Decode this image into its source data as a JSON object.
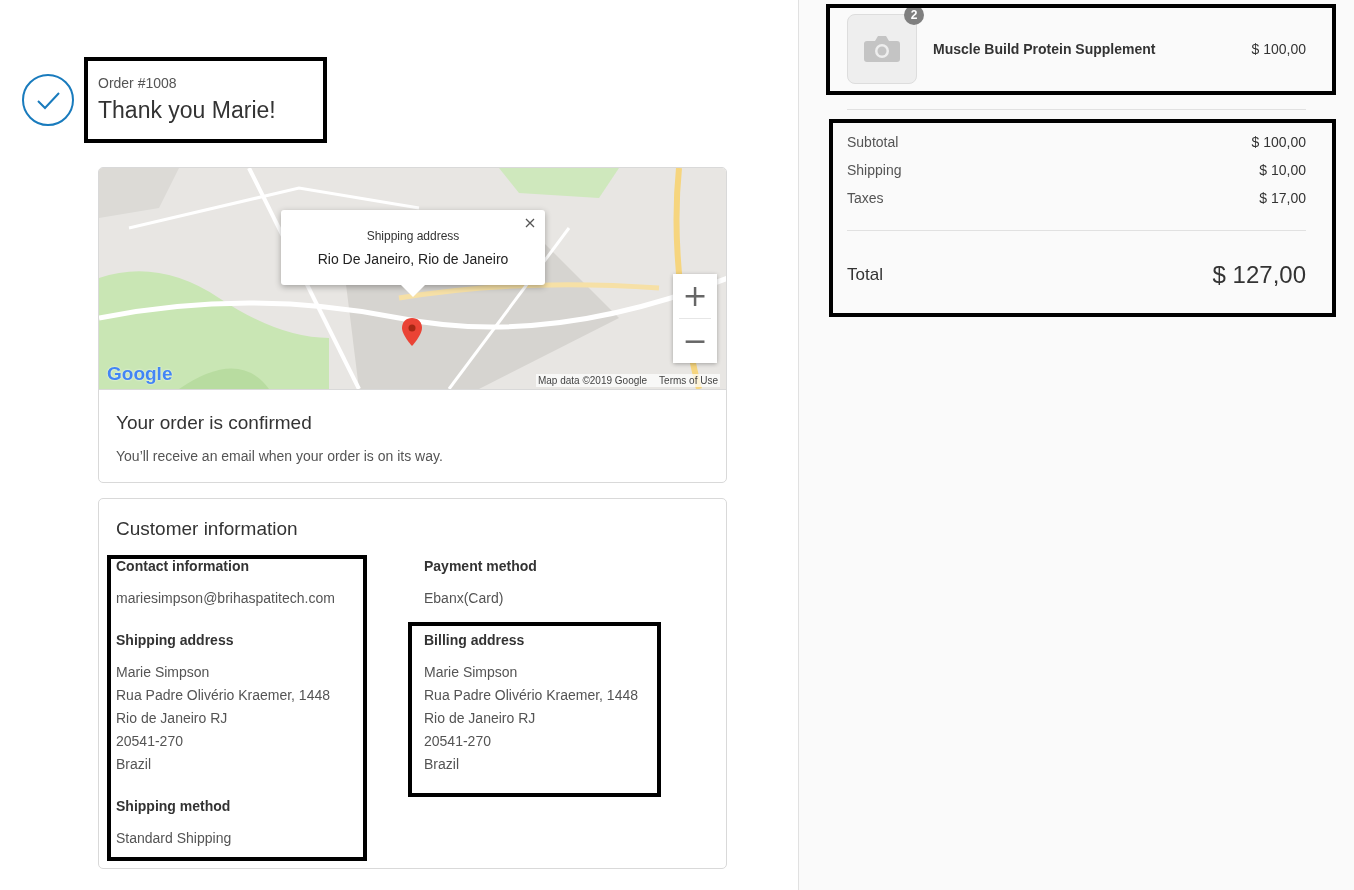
{
  "order": {
    "number": "Order #1008",
    "greeting": "Thank you Marie!"
  },
  "map": {
    "kind": "picture",
    "info_window": {
      "title": "Shipping address",
      "address": "Rio De Janeiro, Rio de Janeiro"
    },
    "zoom_in": "+",
    "zoom_out": "−",
    "logo": "Google",
    "attribution": "Map data ©2019 Google",
    "terms": "Terms of Use"
  },
  "confirmation": {
    "title": "Your order is confirmed",
    "text": "You’ll receive an email when your order is on its way."
  },
  "customer": {
    "title": "Customer information",
    "left": [
      {
        "heading": "Contact information",
        "lines": [
          "mariesimpson@brihaspatitech.com"
        ]
      },
      {
        "heading": "Shipping address",
        "lines": [
          "Marie Simpson",
          "Rua Padre Olivério Kraemer, 1448",
          "Rio de Janeiro RJ",
          "20541-270",
          "Brazil"
        ]
      },
      {
        "heading": "Shipping method",
        "lines": [
          "Standard Shipping"
        ]
      }
    ],
    "right": [
      {
        "heading": "Payment method",
        "lines": [
          "Ebanx(Card)"
        ]
      },
      {
        "heading": "Billing address",
        "lines": [
          "Marie Simpson",
          "Rua Padre Olivério Kraemer, 1448",
          "Rio de Janeiro RJ",
          "20541-270",
          "Brazil"
        ]
      }
    ]
  },
  "cart": {
    "items": [
      {
        "quantity": "2",
        "name": "Muscle Build Protein Supplement",
        "price": "$ 100,00"
      }
    ],
    "summary": [
      {
        "label": "Subtotal",
        "value": "$ 100,00"
      },
      {
        "label": "Shipping",
        "value": "$ 10,00"
      },
      {
        "label": "Taxes",
        "value": "$ 17,00"
      }
    ],
    "total": {
      "label": "Total",
      "value": "$ 127,00"
    }
  }
}
